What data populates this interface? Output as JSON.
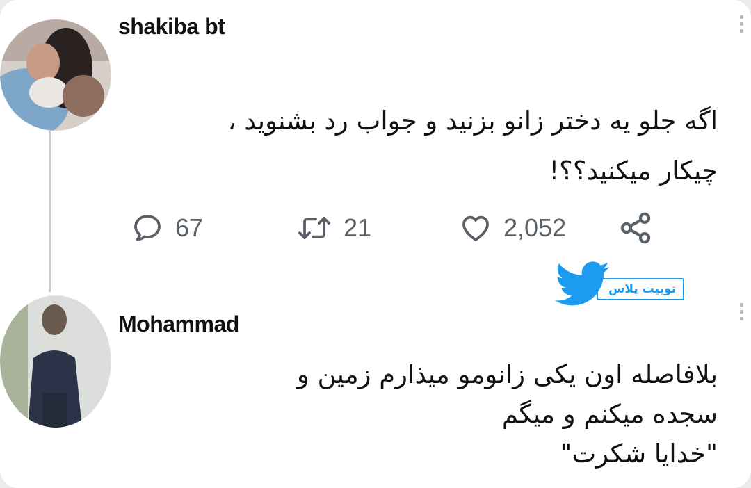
{
  "tweet": {
    "author": "shakiba bt",
    "lines": [
      "اگه جلو یه دختر زانو بزنید و جواب رد بشنوید ،",
      "چیکار میکنید؟؟!"
    ],
    "stats": {
      "replies": "67",
      "retweets": "21",
      "likes": "2,052"
    }
  },
  "reply": {
    "author": "Mohammad",
    "lines": [
      "بلافاصله اون یکی زانومو میذارم زمین و",
      "سجده میکنم و میگم",
      "\"خدایا شکرت\""
    ]
  },
  "watermark": {
    "text": "توییت پلاس"
  },
  "icons": {
    "reply": "comment-bubble-icon",
    "retweet": "retweet-icon",
    "like": "heart-icon",
    "share": "share-icon",
    "logo": "twitter-bird-icon"
  },
  "colors": {
    "accent": "#1d9bf0",
    "icon_gray": "#5a6067",
    "text": "#111111"
  }
}
